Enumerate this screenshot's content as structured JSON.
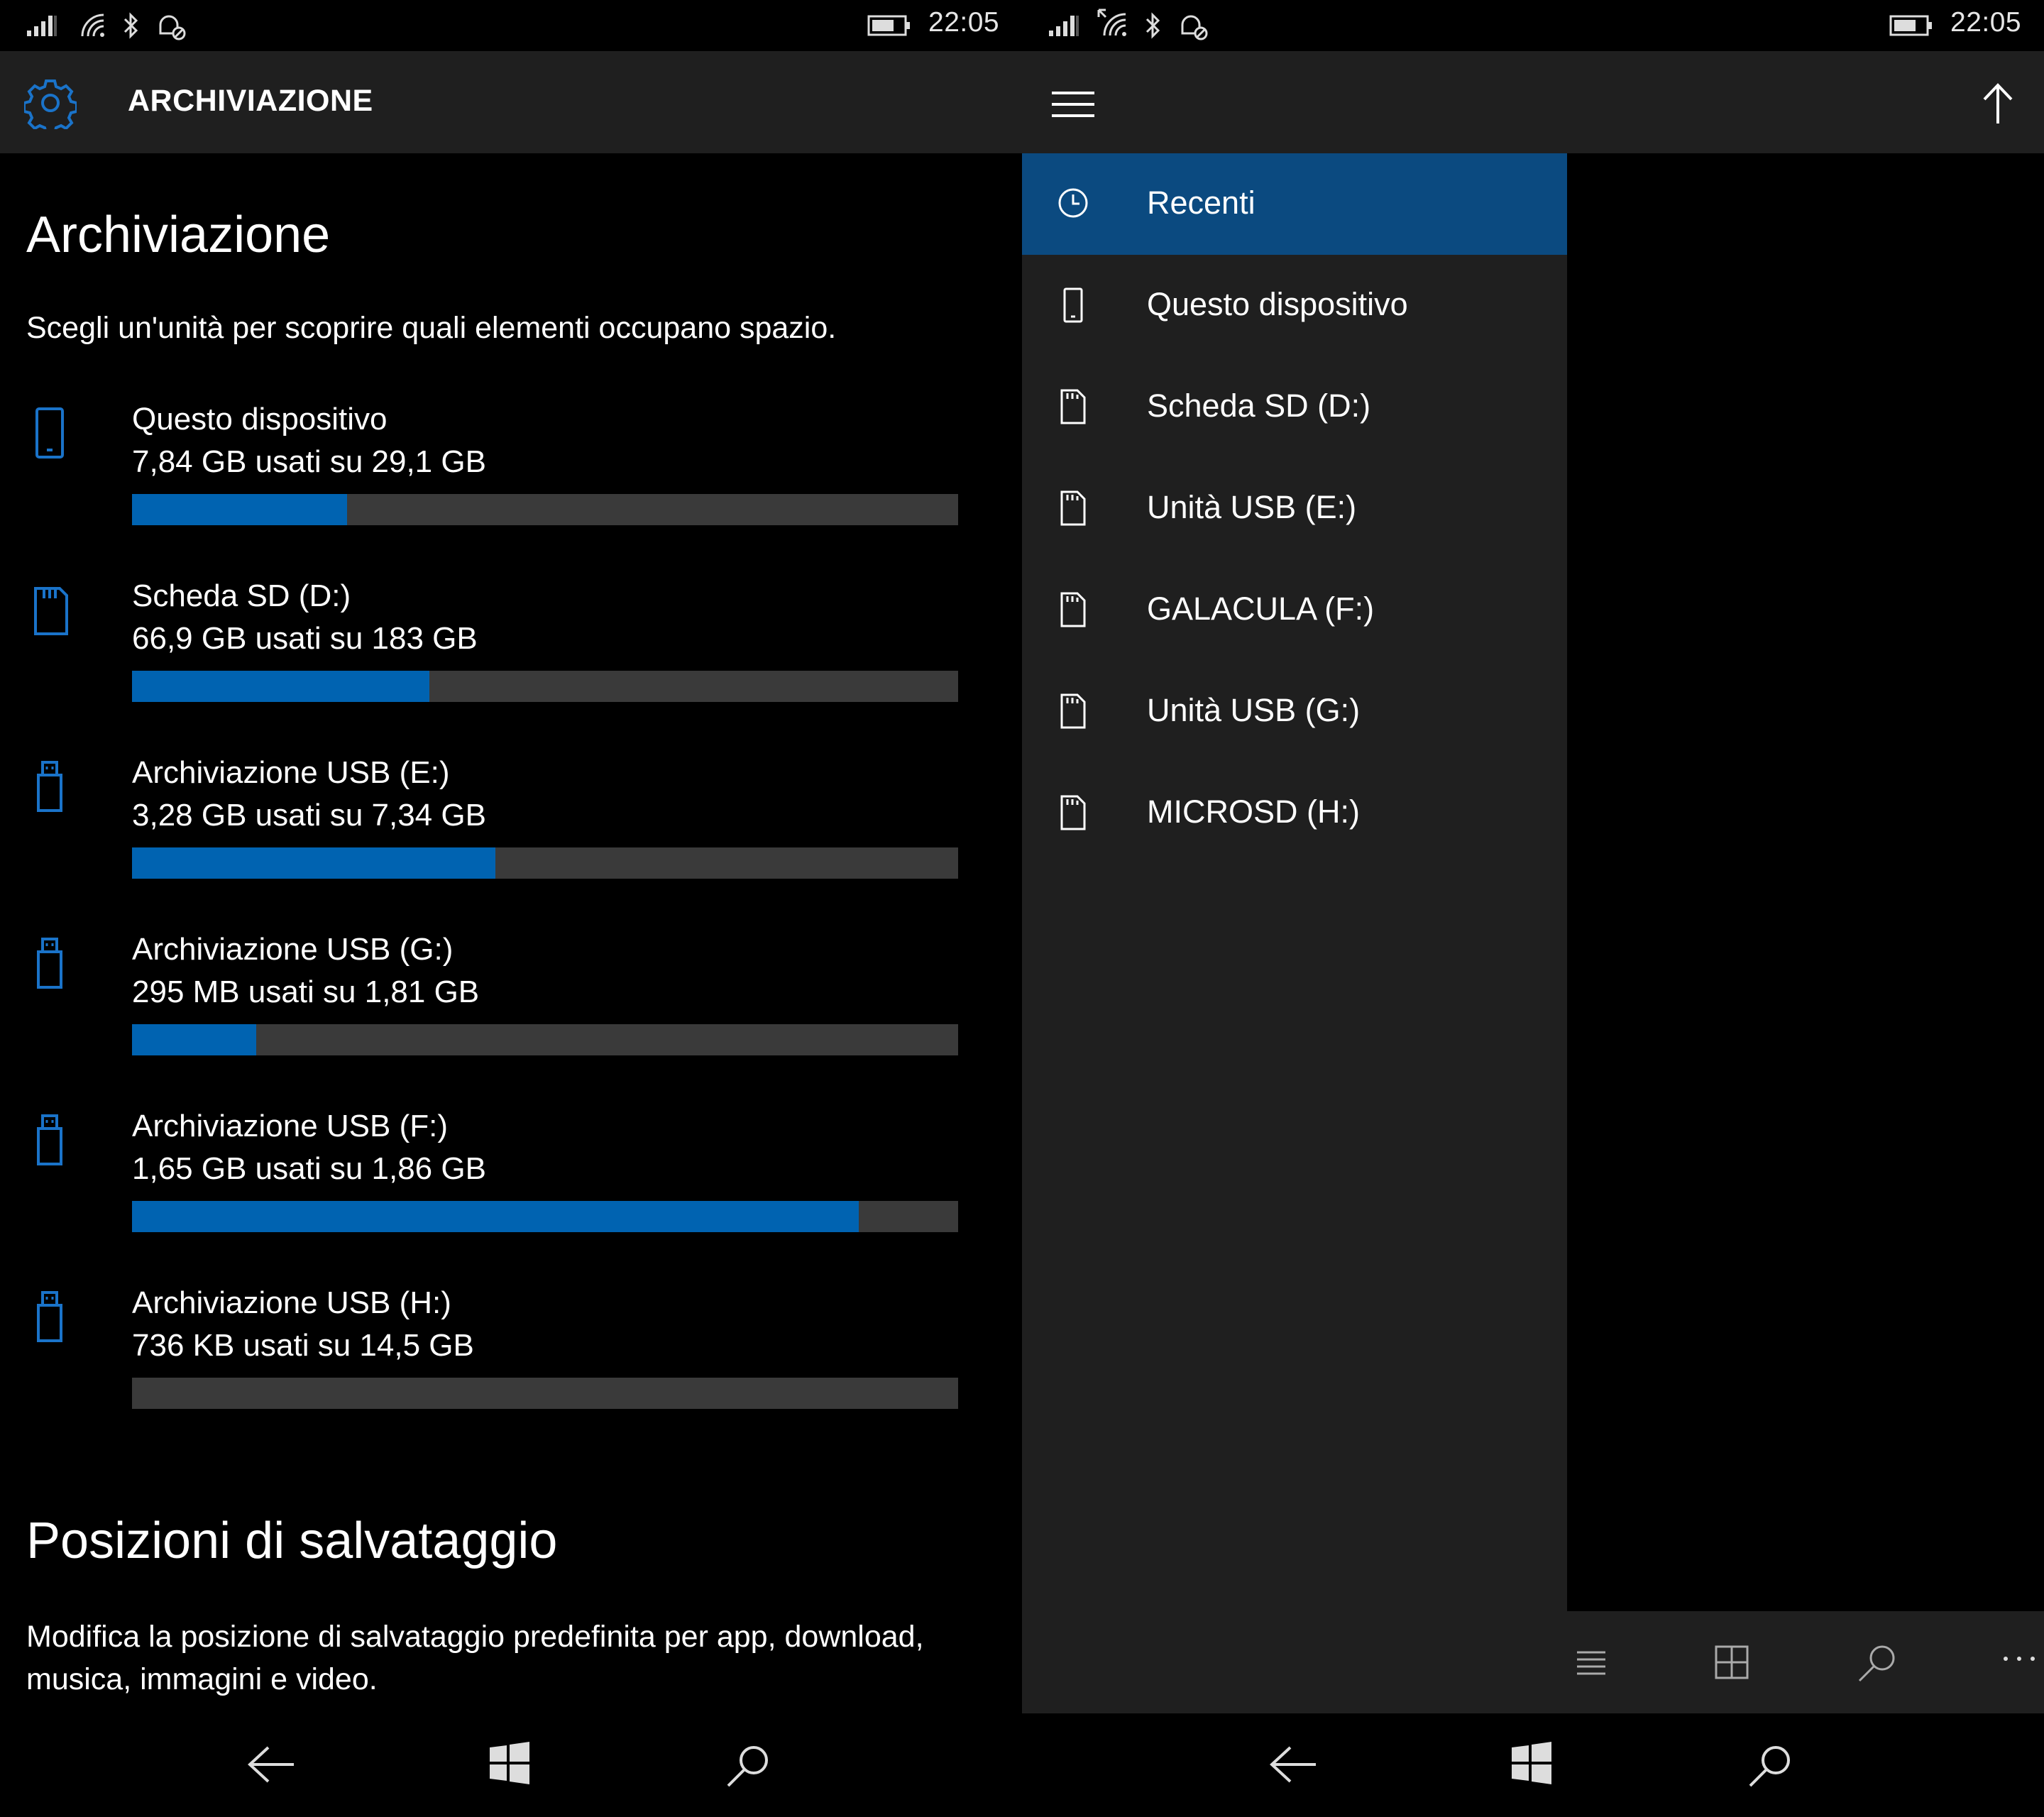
{
  "left": {
    "status": {
      "time": "22:05"
    },
    "header_title": "ARCHIVIAZIONE",
    "section1_title": "Archiviazione",
    "section1_description": "Scegli un'unità per scoprire quali elementi occupano spazio.",
    "drives": [
      {
        "name": "Questo dispositivo",
        "usage": "7,84 GB usati su 29,1 GB",
        "icon": "phone-icon",
        "fill": 0.26
      },
      {
        "name": "Scheda SD (D:)",
        "usage": "66,9 GB usati su 183 GB",
        "icon": "sd-card-icon",
        "fill": 0.36
      },
      {
        "name": "Archiviazione USB (E:)",
        "usage": "3,28 GB usati su 7,34 GB",
        "icon": "usb-drive-icon",
        "fill": 0.44
      },
      {
        "name": "Archiviazione USB (G:)",
        "usage": "295 MB usati su 1,81 GB",
        "icon": "usb-drive-icon",
        "fill": 0.15
      },
      {
        "name": "Archiviazione USB (F:)",
        "usage": "1,65 GB usati su 1,86 GB",
        "icon": "usb-drive-icon",
        "fill": 0.88
      },
      {
        "name": "Archiviazione USB (H:)",
        "usage": "736 KB usati su 14,5 GB",
        "icon": "usb-drive-icon",
        "fill": 0.0
      }
    ],
    "section2_title": "Posizioni di salvataggio",
    "section2_description_line1": "Modifica la posizione di salvataggio predefinita per app, download,",
    "section2_description_line2": "musica, immagini e video."
  },
  "right": {
    "status": {
      "time": "22:05"
    },
    "nav_items": [
      {
        "label": "Recenti",
        "icon": "clock-icon",
        "active": true
      },
      {
        "label": "Questo dispositivo",
        "icon": "phone-icon",
        "active": false
      },
      {
        "label": "Scheda SD (D:)",
        "icon": "sd-card-icon",
        "active": false
      },
      {
        "label": "Unità USB (E:)",
        "icon": "sd-card-icon",
        "active": false
      },
      {
        "label": "GALACULA (F:)",
        "icon": "sd-card-icon",
        "active": false
      },
      {
        "label": "Unità USB (G:)",
        "icon": "sd-card-icon",
        "active": false
      },
      {
        "label": "MICROSD (H:)",
        "icon": "sd-card-icon",
        "active": false
      }
    ],
    "command_bar": [
      "list-view-icon",
      "grid-view-icon",
      "search-icon",
      "more-icon"
    ]
  },
  "colors": {
    "accent": "#0063b1",
    "active_nav": "#0b4a80",
    "bar_track": "#3a3a3a",
    "chrome": "#1f1f1f",
    "background": "#000000"
  }
}
